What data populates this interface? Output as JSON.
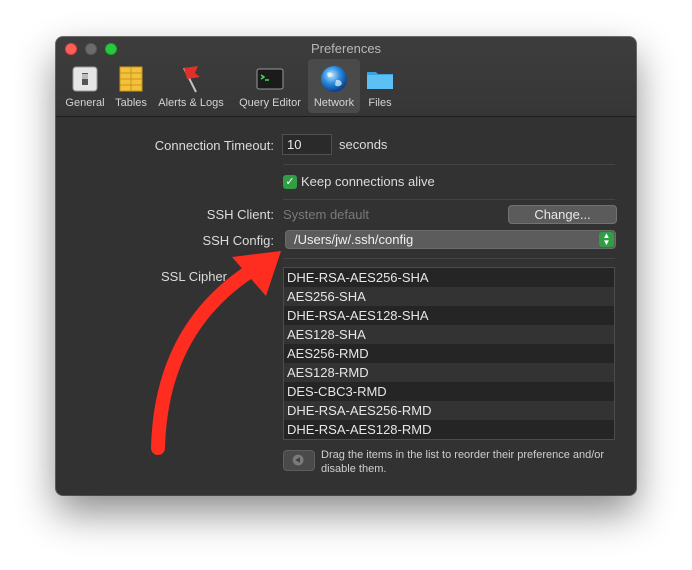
{
  "window": {
    "title": "Preferences"
  },
  "toolbar": {
    "items": [
      {
        "label": "General",
        "icon": "general-icon"
      },
      {
        "label": "Tables",
        "icon": "tables-icon"
      },
      {
        "label": "Alerts & Logs",
        "icon": "alerts-flag-icon"
      },
      {
        "label": "Query Editor",
        "icon": "terminal-icon"
      },
      {
        "label": "Network",
        "icon": "globe-icon",
        "selected": true
      },
      {
        "label": "Files",
        "icon": "folder-icon"
      }
    ]
  },
  "network": {
    "timeout_label": "Connection Timeout:",
    "timeout_value": "10",
    "timeout_unit": "seconds",
    "keep_alive_label": "Keep connections alive",
    "keep_alive_checked": true,
    "ssh_client_label": "SSH Client:",
    "ssh_client_value": "System default",
    "change_button": "Change...",
    "ssh_config_label": "SSH Config:",
    "ssh_config_value": "/Users/jw/.ssh/config",
    "ssl_label": "SSL Cipher",
    "ciphers": [
      "DHE-RSA-AES256-SHA",
      "AES256-SHA",
      "DHE-RSA-AES128-SHA",
      "AES128-SHA",
      "AES256-RMD",
      "AES128-RMD",
      "DES-CBC3-RMD",
      "DHE-RSA-AES256-RMD",
      "DHE-RSA-AES128-RMD"
    ],
    "hint": "Drag the items in the list to reorder their preference and/or disable them."
  },
  "colors": {
    "accent_green": "#2f9e44",
    "annotation_arrow": "#ff2d20"
  }
}
